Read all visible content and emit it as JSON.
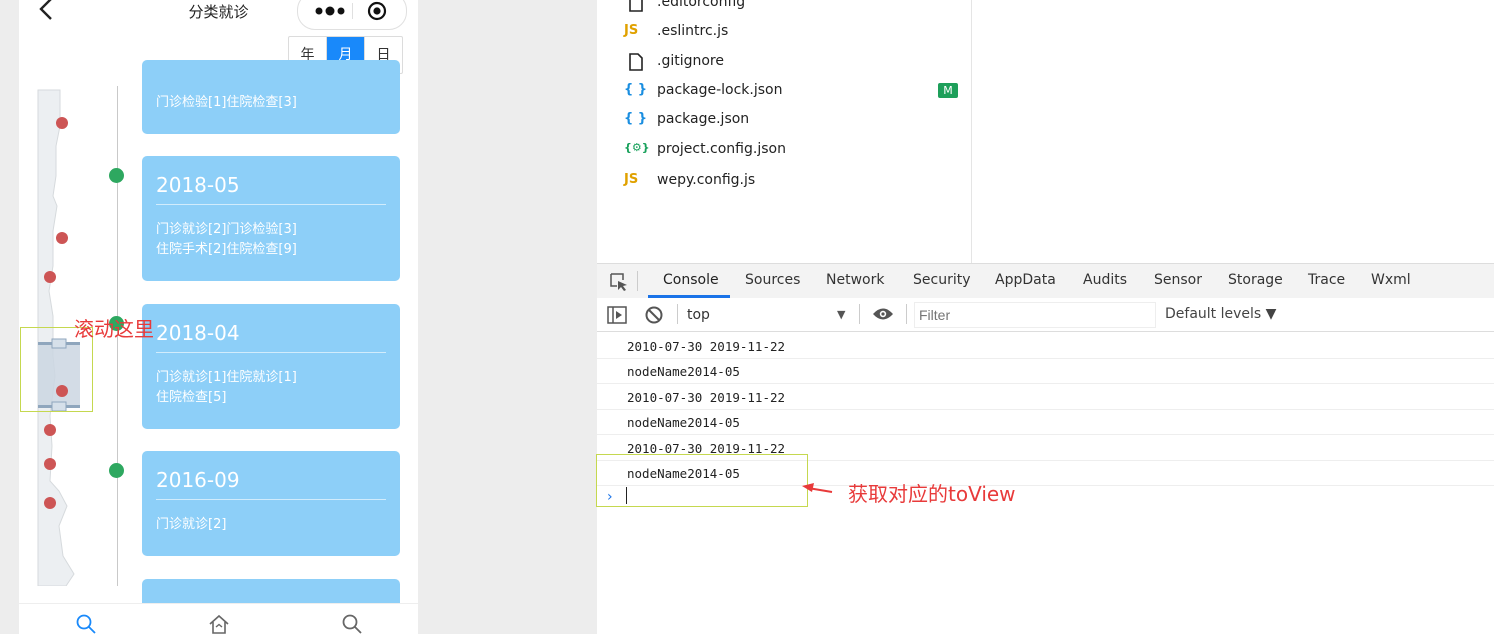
{
  "phone": {
    "title": "分类就诊",
    "segments": [
      "年",
      "月",
      "日"
    ],
    "active_segment": "月",
    "cards": [
      {
        "date": "",
        "lines": [
          "门诊检验[1]住院检查[3]"
        ]
      },
      {
        "date": "2018-05",
        "lines": [
          "门诊就诊[2]门诊检验[3]",
          "住院手术[2]住院检查[9]"
        ]
      },
      {
        "date": "2018-04",
        "lines": [
          "门诊就诊[1]住院就诊[1]",
          "住院检查[5]"
        ]
      },
      {
        "date": "2016-09",
        "lines": [
          "门诊就诊[2]"
        ]
      }
    ],
    "tabbar_icons": [
      "search-icon",
      "home-icon",
      "search-icon"
    ]
  },
  "annotations": {
    "scroll_here": "滚动这里",
    "get_toview": "获取对应的toView"
  },
  "explorer": {
    "files": [
      {
        "icon": "file-icon",
        "name": ".editorconfig"
      },
      {
        "icon": "js-icon",
        "name": ".eslintrc.js"
      },
      {
        "icon": "file-icon",
        "name": ".gitignore"
      },
      {
        "icon": "json-icon",
        "name": "package-lock.json",
        "badge": "M"
      },
      {
        "icon": "json-icon",
        "name": "package.json"
      },
      {
        "icon": "config-json-icon",
        "name": "project.config.json"
      },
      {
        "icon": "js-icon",
        "name": "wepy.config.js"
      }
    ]
  },
  "devtools": {
    "tabs": [
      "Console",
      "Sources",
      "Network",
      "Security",
      "AppData",
      "Audits",
      "Sensor",
      "Storage",
      "Trace",
      "Wxml"
    ],
    "active_tab": "Console",
    "context": "top",
    "filter_placeholder": "Filter",
    "levels": "Default levels ▼"
  },
  "console": {
    "lines": [
      "2010-07-30 2019-11-22",
      "nodeName2014-05",
      "2010-07-30 2019-11-22",
      "nodeName2014-05",
      "2010-07-30 2019-11-22",
      "nodeName2014-05"
    ],
    "prompt": "›"
  },
  "colors": {
    "card": "#8dcff8",
    "accent": "#1989fa",
    "timeline_dot": "#2ea860",
    "annotation": "#e83a3a"
  }
}
